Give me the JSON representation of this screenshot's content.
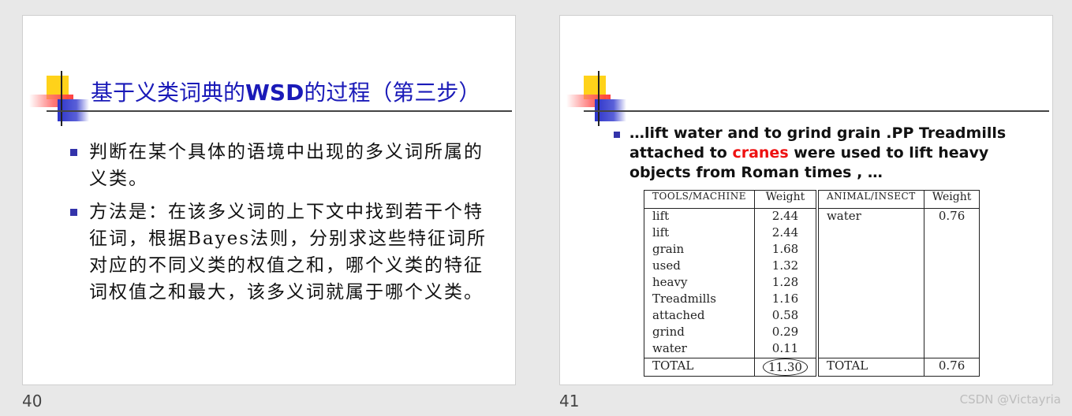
{
  "slide40": {
    "title_prefix": "基于义类词典的",
    "title_bold": "WSD",
    "title_suffix": "的过程（第三步）",
    "bullets": [
      "判断在某个具体的语境中出现的多义词所属的义类。",
      "方法是：在该多义词的上下文中找到若干个特征词，根据Bayes法则，分别求这些特征词所对应的不同义类的权值之和，哪个义类的特征词权值之和最大，该多义词就属于哪个义类。"
    ],
    "page_number": "40"
  },
  "slide41": {
    "text_before": "…lift water and to grind grain .PP Treadmills attached to ",
    "highlight": "cranes",
    "text_after": " were used to lift heavy objects from Roman times , …",
    "highlight_color": "#ee1111",
    "table": {
      "headers": [
        "TOOLS/MACHINE",
        "Weight",
        "ANIMAL/INSECT",
        "Weight"
      ],
      "rows": [
        [
          "lift",
          "2.44",
          "water",
          "0.76"
        ],
        [
          "lift",
          "2.44",
          "",
          ""
        ],
        [
          "grain",
          "1.68",
          "",
          ""
        ],
        [
          "used",
          "1.32",
          "",
          ""
        ],
        [
          "heavy",
          "1.28",
          "",
          ""
        ],
        [
          "Treadmills",
          "1.16",
          "",
          ""
        ],
        [
          "attached",
          "0.58",
          "",
          ""
        ],
        [
          "grind",
          "0.29",
          "",
          ""
        ],
        [
          "water",
          "0.11",
          "",
          ""
        ]
      ],
      "total_label_1": "TOTAL",
      "total_value_1": "11.30",
      "total_label_2": "TOTAL",
      "total_value_2": "0.76"
    },
    "page_number": "41"
  },
  "watermark": "CSDN @Victayria",
  "colors": {
    "title_blue": "#1a1ab8",
    "bullet_blue": "#3333aa",
    "logo_yellow": "#ffd21a",
    "logo_red": "#ff2b2b",
    "logo_blue": "#2b33c9"
  }
}
